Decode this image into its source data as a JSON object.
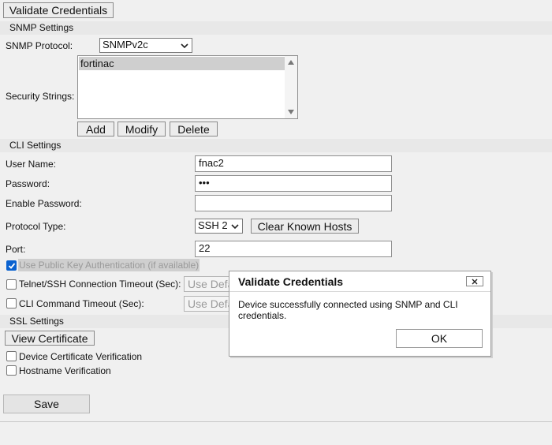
{
  "validate_button": "Validate Credentials",
  "snmp": {
    "section_title": "SNMP Settings",
    "protocol_label": "SNMP Protocol:",
    "protocol_value": "SNMPv2c",
    "security_label": "Security Strings:",
    "security_items": [
      "fortinac"
    ],
    "add": "Add",
    "modify": "Modify",
    "delete": "Delete"
  },
  "cli": {
    "section_title": "CLI Settings",
    "username_label": "User Name:",
    "username_value": "fnac2",
    "password_label": "Password:",
    "password_value": "•••",
    "enable_password_label": "Enable Password:",
    "enable_password_value": "",
    "protocol_type_label": "Protocol Type:",
    "protocol_type_value": "SSH 2",
    "clear_known_hosts": "Clear Known Hosts",
    "port_label": "Port:",
    "port_value": "22",
    "public_key_label": "Use Public Key Authentication (if available)",
    "public_key_checked": true,
    "timeout_label": "Telnet/SSH Connection Timeout (Sec):",
    "timeout_placeholder": "Use Default",
    "cmd_timeout_label": "CLI Command Timeout (Sec):",
    "cmd_timeout_placeholder": "Use Default"
  },
  "ssl": {
    "section_title": "SSL Settings",
    "view_certificate": "View Certificate",
    "device_cert_label": "Device Certificate Verification",
    "hostname_label": "Hostname Verification"
  },
  "save": "Save",
  "dialog": {
    "title": "Validate Credentials",
    "message": "Device successfully connected using SNMP and CLI credentials.",
    "ok": "OK"
  },
  "colors": {
    "accent": "#0a62d0",
    "background": "#f0f0f0",
    "section": "#e8e8e8"
  }
}
